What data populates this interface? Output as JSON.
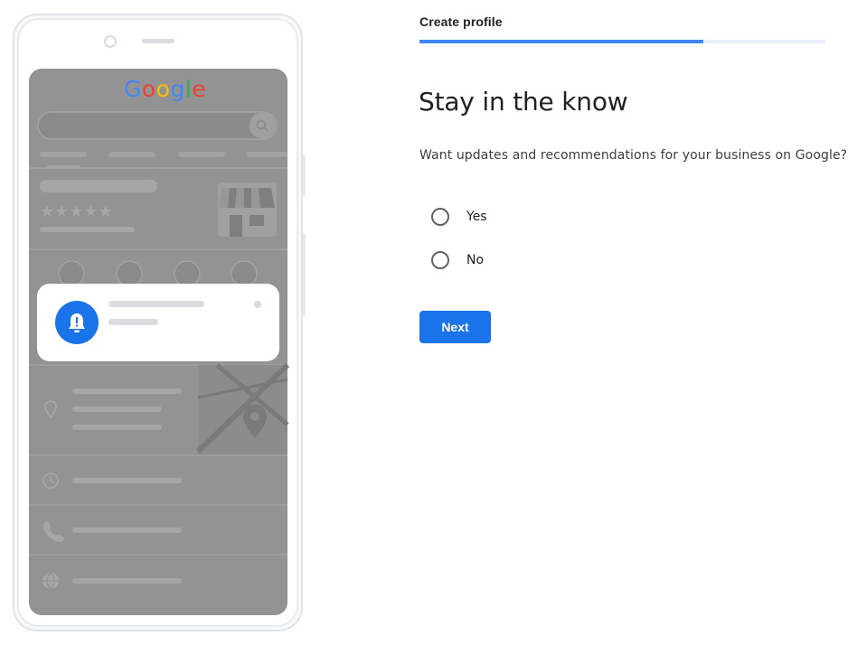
{
  "illustration": {
    "logo_letters": [
      {
        "char": "G",
        "color": "#4285f4"
      },
      {
        "char": "o",
        "color": "#ea4335"
      },
      {
        "char": "o",
        "color": "#fbbc05"
      },
      {
        "char": "g",
        "color": "#4285f4"
      },
      {
        "char": "l",
        "color": "#34a853"
      },
      {
        "char": "e",
        "color": "#ea4335"
      }
    ],
    "notification_icon": "bell-alert-icon"
  },
  "form": {
    "step_title": "Create profile",
    "progress_fraction": 0.7,
    "heading": "Stay in the know",
    "question": "Want updates and recommendations for your business on Google?",
    "options": [
      {
        "label": "Yes",
        "selected": false
      },
      {
        "label": "No",
        "selected": false
      }
    ],
    "next_label": "Next"
  },
  "colors": {
    "accent": "#1a73e8",
    "progress": "#4285f4",
    "progress_track": "#e8f0fe"
  }
}
